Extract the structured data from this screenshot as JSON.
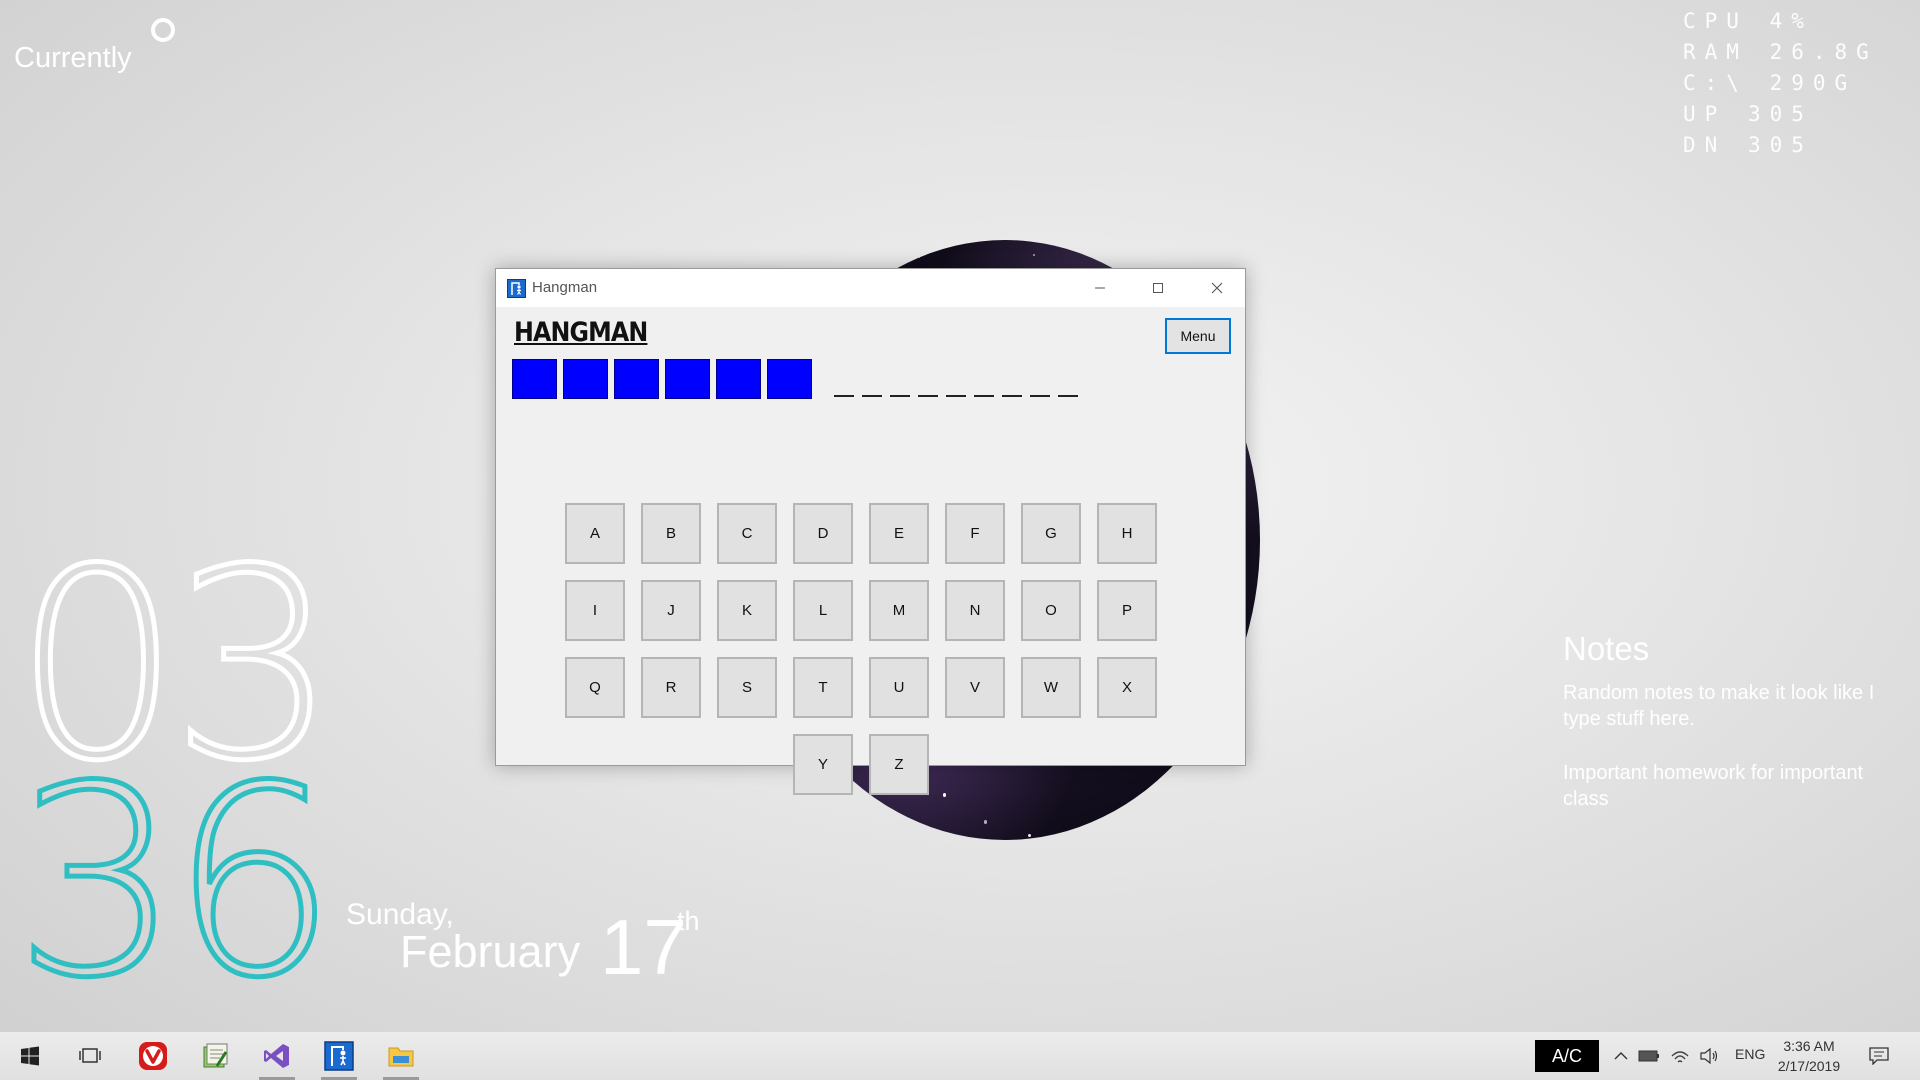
{
  "desktop": {
    "currently_label": "Currently",
    "system_stats": [
      {
        "label": "CPU",
        "value": "4%"
      },
      {
        "label": "RAM",
        "value": "26.8G"
      },
      {
        "label": "C:\\",
        "value": "290G"
      },
      {
        "label": "UP",
        "value": "305"
      },
      {
        "label": "DN",
        "value": "305"
      }
    ],
    "clock": {
      "hour": "03",
      "minute": "36",
      "hour_color": "#ffffff",
      "minute_color": "#2fbfc2"
    },
    "date": {
      "weekday": "Sunday,",
      "month": "February",
      "day": "17",
      "suffix": "th"
    },
    "notes": {
      "title": "Notes",
      "lines": [
        "Random notes to make it look like I type stuff here.",
        "Important homework for important class"
      ]
    }
  },
  "window": {
    "title": "Hangman",
    "icon": "hangman-app-icon",
    "controls": {
      "minimize": "minimize-icon",
      "maximize": "maximize-icon",
      "close": "close-icon"
    }
  },
  "game": {
    "heading": "HANGMAN",
    "menu_label": "Menu",
    "lives_remaining": 6,
    "life_color": "#0000ff",
    "word_blank_count": 9,
    "letters": [
      [
        "A",
        "B",
        "C",
        "D",
        "E",
        "F",
        "G",
        "H"
      ],
      [
        "I",
        "J",
        "K",
        "L",
        "M",
        "N",
        "O",
        "P"
      ],
      [
        "Q",
        "R",
        "S",
        "T",
        "U",
        "V",
        "W",
        "X"
      ],
      [
        "Y",
        "Z"
      ]
    ]
  },
  "taskbar": {
    "items": [
      {
        "name": "windows-start-icon"
      },
      {
        "name": "task-view-icon"
      },
      {
        "name": "vivaldi-icon"
      },
      {
        "name": "notepad-icon"
      },
      {
        "name": "visual-studio-icon"
      },
      {
        "name": "hangman-app-icon"
      },
      {
        "name": "file-explorer-icon"
      }
    ],
    "ac_label": "A/C",
    "lang": "ENG",
    "time": "3:36 AM",
    "date": "2/17/2019"
  }
}
